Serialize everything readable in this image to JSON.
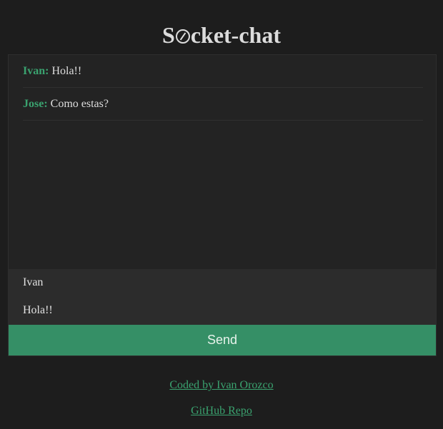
{
  "app": {
    "title_prefix": "S",
    "title_suffix": "cket-chat"
  },
  "messages": [
    {
      "author": "Ivan:",
      "text": "Hola!!"
    },
    {
      "author": "Jose:",
      "text": "Como estas?"
    }
  ],
  "form": {
    "name_value": "Ivan",
    "message_value": "Hola!!",
    "send_label": "Send"
  },
  "footer": {
    "credit_label": "Coded by Ivan Orozco",
    "repo_label": "GitHub Repo"
  },
  "colors": {
    "background": "#1d1d1d",
    "panel": "#232323",
    "input_area": "#2c2c2c",
    "accent": "#358f66",
    "author": "#3aa26f"
  },
  "icons": {
    "title_logo": "compass-icon"
  }
}
